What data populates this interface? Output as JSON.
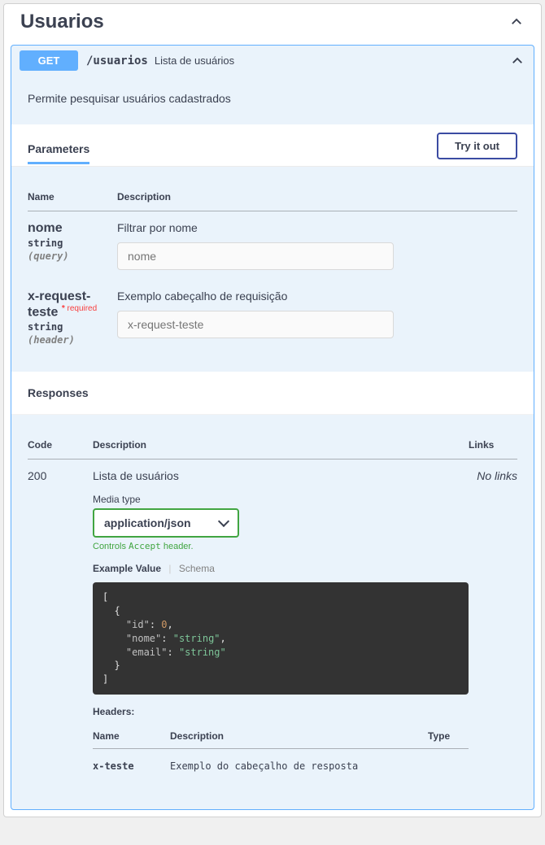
{
  "tag": {
    "title": "Usuarios"
  },
  "op": {
    "method": "GET",
    "path": "/usuarios",
    "summary": "Lista de usuários",
    "description": "Permite pesquisar usuários cadastrados"
  },
  "labels": {
    "parameters": "Parameters",
    "try_it": "Try it out",
    "responses": "Responses",
    "name": "Name",
    "description": "Description",
    "code": "Code",
    "links": "Links",
    "type": "Type",
    "media_type": "Media type",
    "controls_prefix": "Controls ",
    "controls_accept": "Accept",
    "controls_suffix": " header.",
    "example_value": "Example Value",
    "schema": "Schema",
    "headers": "Headers:",
    "required": "required",
    "no_links": "No links"
  },
  "parameters": [
    {
      "name": "nome",
      "required": false,
      "type": "string",
      "in": "(query)",
      "description": "Filtrar por nome",
      "placeholder": "nome"
    },
    {
      "name": "x-request-teste",
      "required": true,
      "type": "string",
      "in": "(header)",
      "description": "Exemplo cabeçalho de requisição",
      "placeholder": "x-request-teste"
    }
  ],
  "response": {
    "code": "200",
    "description": "Lista de usuários",
    "media_type": "application/json",
    "example_lines": [
      {
        "indent": 0,
        "text": "[",
        "type": "punc"
      },
      {
        "indent": 1,
        "text": "{",
        "type": "punc"
      },
      {
        "indent": 2,
        "key": "\"id\"",
        "sep": ": ",
        "val": "0",
        "valtype": "zero",
        "comma": ","
      },
      {
        "indent": 2,
        "key": "\"nome\"",
        "sep": ": ",
        "val": "\"string\"",
        "valtype": "str",
        "comma": ","
      },
      {
        "indent": 2,
        "key": "\"email\"",
        "sep": ": ",
        "val": "\"string\"",
        "valtype": "str",
        "comma": ""
      },
      {
        "indent": 1,
        "text": "}",
        "type": "punc"
      },
      {
        "indent": 0,
        "text": "]",
        "type": "punc"
      }
    ],
    "headers": [
      {
        "name": "x-teste",
        "description": "Exemplo do cabeçalho de resposta",
        "type": ""
      }
    ]
  }
}
